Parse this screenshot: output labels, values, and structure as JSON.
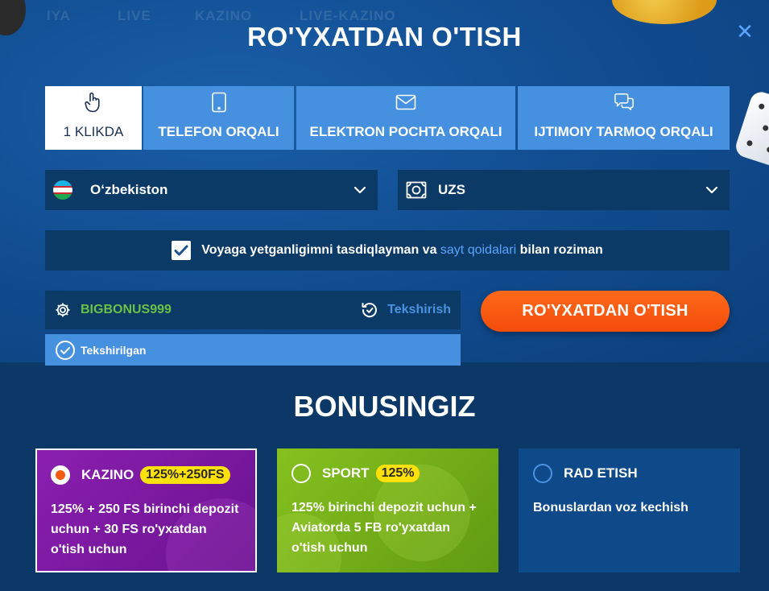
{
  "background_nav": [
    "IYA",
    "LIVE",
    "KAZINO",
    "LIVE-KAZINO"
  ],
  "modal": {
    "title": "RO'YXATDAN O'TISH",
    "close_icon": "close-icon"
  },
  "tabs": [
    {
      "label": "1 KLIKDA",
      "icon": "hand-pointer-icon",
      "active": true
    },
    {
      "label": "TELEFON ORQALI",
      "icon": "phone-icon",
      "active": false
    },
    {
      "label": "ELEKTRON POCHTA ORQALI",
      "icon": "envelope-icon",
      "active": false
    },
    {
      "label": "IJTIMOIY TARMOQ ORQALI",
      "icon": "chat-bubbles-icon",
      "active": false
    }
  ],
  "country_select": {
    "value": "O‘zbekiston",
    "icon": "uzbekistan-flag-icon"
  },
  "currency_select": {
    "value": "UZS",
    "icon": "banknote-icon"
  },
  "agreement": {
    "checked": true,
    "text_before": "Voyaga yetganligimni tasdiqlayman va ",
    "link_text": "sayt qoidalari",
    "text_after": " bilan roziman"
  },
  "promo": {
    "value": "BIGBONUS999",
    "check_label": "Tekshirish",
    "status_label": "Tekshirilgan"
  },
  "register_button": "RO'YXATDAN O'TISH",
  "bonus": {
    "title": "BONUSINGIZ",
    "cards": [
      {
        "name": "KAZINO",
        "badge": "125%+250FS",
        "selected": true,
        "desc": "125% + 250 FS birinchi depozit uchun + 30 FS ro'yxatdan o'tish uchun"
      },
      {
        "name": "SPORT",
        "badge": "125%",
        "selected": false,
        "desc": "125% birinchi depozit uchun + Aviatorda 5 FB ro'yxatdan o'tish uchun"
      },
      {
        "name": "RAD ETISH",
        "badge": "",
        "selected": false,
        "desc": "Bonuslardan voz kechish"
      }
    ]
  },
  "colors": {
    "accent_blue": "#4590df",
    "register_orange": "#f24c0a",
    "promo_green": "#6bc146",
    "badge_yellow": "#ffe10a"
  }
}
